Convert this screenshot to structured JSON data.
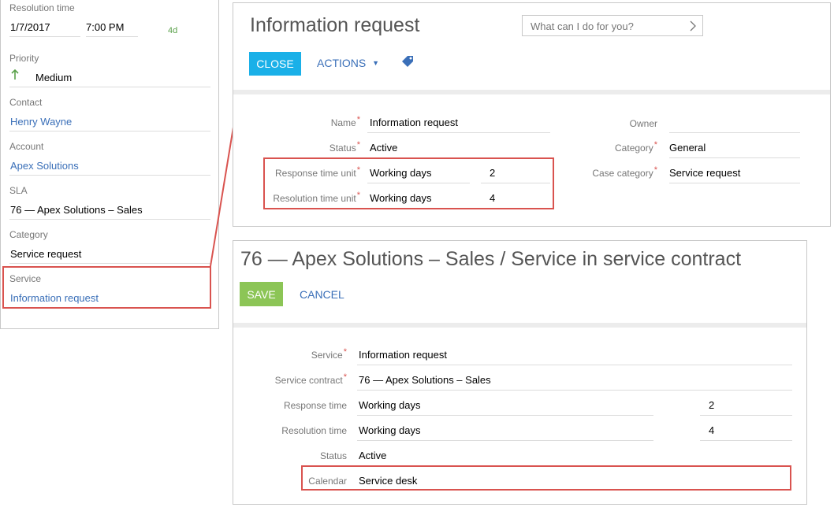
{
  "left_panel": {
    "resolution_time": {
      "label": "Resolution time",
      "date": "1/7/2017",
      "time": "7:00 PM",
      "remaining": "4d"
    },
    "priority": {
      "label": "Priority",
      "value": "Medium",
      "icon": "arrow-up-icon"
    },
    "contact": {
      "label": "Contact",
      "value": "Henry Wayne"
    },
    "account": {
      "label": "Account",
      "value": "Apex Solutions"
    },
    "sla": {
      "label": "SLA",
      "value": "76 — Apex Solutions – Sales"
    },
    "category": {
      "label": "Category",
      "value": "Service request"
    },
    "service": {
      "label": "Service",
      "value": "Information request"
    }
  },
  "info_card": {
    "title": "Information request",
    "search_placeholder": "What can I do for you?",
    "close_label": "CLOSE",
    "actions_label": "ACTIONS",
    "fields_left": [
      {
        "label": "Name",
        "value": "Information request",
        "required": true
      },
      {
        "label": "Status",
        "value": "Active",
        "required": true
      },
      {
        "label": "Response time unit",
        "value": "Working days",
        "number": "2",
        "required": true
      },
      {
        "label": "Resolution time unit",
        "value": "Working days",
        "number": "4",
        "required": true
      }
    ],
    "fields_right": [
      {
        "label": "Owner",
        "value": "",
        "required": false
      },
      {
        "label": "Category",
        "value": "General",
        "required": true
      },
      {
        "label": "Case category",
        "value": "Service request",
        "required": true
      }
    ]
  },
  "contract_card": {
    "title": "76 — Apex Solutions – Sales / Service in service contract",
    "save_label": "SAVE",
    "cancel_label": "CANCEL",
    "fields": [
      {
        "label": "Service",
        "value": "Information request",
        "required": true
      },
      {
        "label": "Service contract",
        "value": "76 — Apex Solutions – Sales",
        "required": true
      },
      {
        "label": "Response time",
        "value": "Working days",
        "number": "2",
        "required": false
      },
      {
        "label": "Resolution time",
        "value": "Working days",
        "number": "4",
        "required": false
      },
      {
        "label": "Status",
        "value": "Active",
        "required": false
      },
      {
        "label": "Calendar",
        "value": "Service desk",
        "required": false
      }
    ]
  },
  "colors": {
    "accent_blue": "#1ab0e8",
    "save_green": "#8cc556",
    "highlight_red": "#d9534f",
    "link_blue": "#3a6fb8"
  }
}
